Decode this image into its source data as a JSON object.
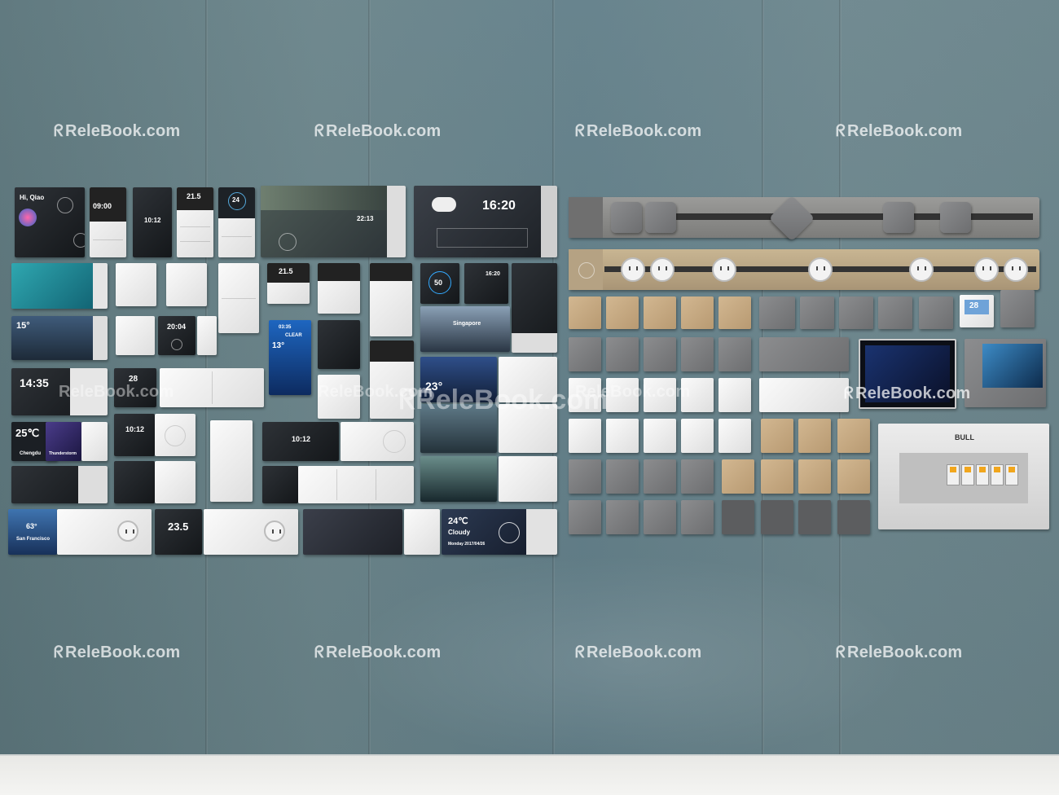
{
  "watermark": {
    "text": "ReleBook.com"
  },
  "left_wall": {
    "welcome_name": "Hi, Qiao",
    "time_1": "09:00",
    "time_2": "10:12",
    "temp_1": "21.5",
    "dial_temp": "24",
    "big_time": "16:20",
    "temp_15": "15°",
    "time_2004": "20:04",
    "time_1435": "14:35",
    "temp_28": "28",
    "temp_25": "25℃",
    "city_chengdu": "Chengdu",
    "weather_thunder": "Thunderstorm",
    "time_1012b": "10:12",
    "time_1012c": "10:12",
    "temp_21_5b": "21.5",
    "gauge_50": "50",
    "small_1620": "16:20",
    "city_singapore": "Singapore",
    "temp_23": "23°",
    "temp_13": "13°",
    "weather_clear": "CLEAR",
    "time_0335": "03:35",
    "temp_63": "63°",
    "city_sf": "San Francisco",
    "temp_235": "23.5",
    "temp_24c": "24℃",
    "weather_cloudy": "Cloudy",
    "date_text": "Monday 2017/04/26",
    "time_2213": "22:13"
  },
  "right_wall": {
    "brand": "BULL",
    "thermostat": "28"
  }
}
